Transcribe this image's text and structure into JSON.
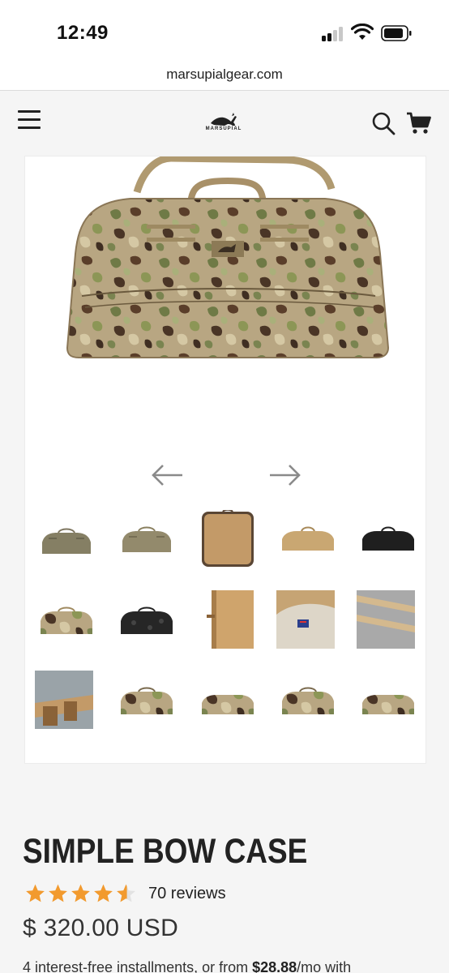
{
  "status_bar": {
    "time": "12:49"
  },
  "browser": {
    "url": "marsupialgear.com"
  },
  "header": {
    "logo_text": "MARSUPIAL",
    "menu_icon": "hamburger-icon",
    "search_icon": "search-icon",
    "cart_icon": "cart-icon"
  },
  "gallery": {
    "prev_icon": "arrow-left-icon",
    "next_icon": "arrow-right-icon",
    "thumbnails": [
      {
        "name": "ranger-green-case"
      },
      {
        "name": "olive-case"
      },
      {
        "name": "open-coyote-case"
      },
      {
        "name": "coyote-case"
      },
      {
        "name": "black-case"
      },
      {
        "name": "multicam-case"
      },
      {
        "name": "black-multicam-case"
      },
      {
        "name": "interior-panel-detail"
      },
      {
        "name": "flag-patch-detail"
      },
      {
        "name": "strap-detail"
      },
      {
        "name": "buckle-detail"
      },
      {
        "name": "camo-case-1"
      },
      {
        "name": "camo-case-2"
      },
      {
        "name": "camo-case-3"
      },
      {
        "name": "camo-case-4"
      }
    ]
  },
  "product": {
    "title": "SIMPLE BOW CASE",
    "rating": 4.5,
    "rating_max": 5,
    "reviews": "70 reviews",
    "price": "$ 320.00 USD",
    "installments_prefix": "4 interest-free installments, or from ",
    "installments_amount": "$28.88",
    "installments_suffix": "/mo with",
    "star_color": "#f29a2e"
  }
}
